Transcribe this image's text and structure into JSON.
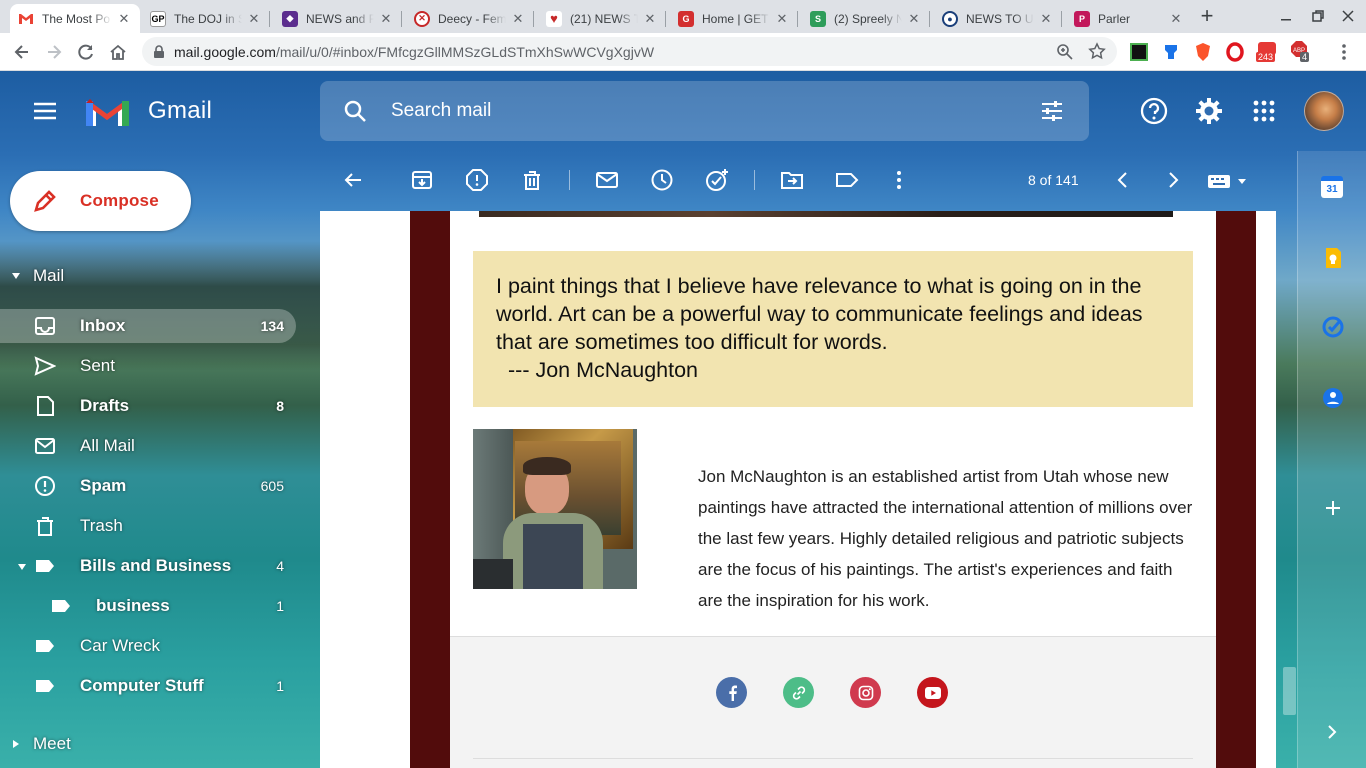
{
  "browser": {
    "tabs": [
      {
        "title": "The Most Po",
        "favicon": "gmail-icon"
      },
      {
        "title": "The DOJ in S",
        "favicon": "gp-icon"
      },
      {
        "title": "NEWS and F",
        "favicon": "shield-icon"
      },
      {
        "title": "Deecy - Fem",
        "favicon": "deecy-icon"
      },
      {
        "title": "(21) NEWS T",
        "favicon": "heart-icon"
      },
      {
        "title": "Home | GET",
        "favicon": "gettr-icon"
      },
      {
        "title": "(2) Spreely N",
        "favicon": "spreely-icon"
      },
      {
        "title": "NEWS TO U",
        "favicon": "globe-icon"
      },
      {
        "title": "Parler",
        "favicon": "parler-icon"
      }
    ],
    "url_host": "mail.google.com",
    "url_path": "/mail/u/0/#inbox/FMfcgzGllMMSzGLdSTmXhSwWCVgXgjvW",
    "ext_badges": {
      "adblock": "243",
      "abp": "4"
    }
  },
  "gmail": {
    "logo_text": "Gmail",
    "search_placeholder": "Search mail",
    "compose_label": "Compose",
    "mail_section": "Mail",
    "meet_section": "Meet",
    "nav": [
      {
        "label": "Inbox",
        "count": "134",
        "bold": true,
        "icon": "inbox-icon",
        "selected": true
      },
      {
        "label": "Sent",
        "count": "",
        "bold": false,
        "icon": "send-icon"
      },
      {
        "label": "Drafts",
        "count": "8",
        "bold": true,
        "icon": "draft-icon"
      },
      {
        "label": "All Mail",
        "count": "",
        "bold": false,
        "icon": "mail-icon"
      },
      {
        "label": "Spam",
        "count": "605",
        "bold": true,
        "icon": "spam-icon"
      },
      {
        "label": "Trash",
        "count": "",
        "bold": false,
        "icon": "trash-icon"
      },
      {
        "label": "Bills and Business",
        "count": "4",
        "bold": true,
        "icon": "label-icon"
      },
      {
        "label": "business",
        "count": "1",
        "bold": true,
        "icon": "label-icon"
      },
      {
        "label": "Car Wreck",
        "count": "",
        "bold": false,
        "icon": "label-icon"
      },
      {
        "label": "Computer Stuff",
        "count": "1",
        "bold": true,
        "icon": "label-icon"
      }
    ],
    "pager": "8 of 141",
    "message": {
      "quote": "I paint things that I believe have relevance to what is going on in the world. Art can be a powerful way to communicate feelings and ideas that are sometimes too difficult for words.",
      "quote_author": "--- Jon McNaughton",
      "bio": "Jon McNaughton is an established artist from Utah whose new paintings have attracted the international attention of millions over the last few years. Highly detailed religious and patriotic subjects are the focus of his paintings. The artist's experiences and faith are the inspiration for his work."
    },
    "social": [
      {
        "name": "facebook",
        "color": "#4a6ea9"
      },
      {
        "name": "link",
        "color": "#4dbd88"
      },
      {
        "name": "instagram",
        "color": "#d03a4e"
      },
      {
        "name": "youtube",
        "color": "#c4151c"
      }
    ],
    "side_panel": [
      "calendar-icon",
      "keep-icon",
      "tasks-icon",
      "contacts-icon",
      "add-icon"
    ],
    "calendar_day": "31"
  }
}
